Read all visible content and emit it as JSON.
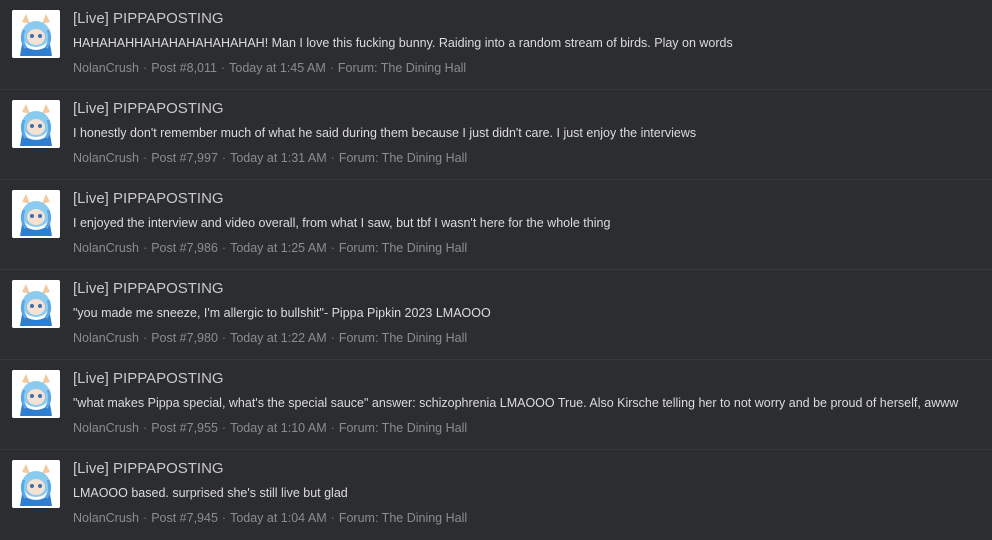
{
  "colors": {
    "background": "#2b2d31",
    "title": "#c9c9c9",
    "snippet": "#dcdcdc",
    "meta": "#8a8c90"
  },
  "separator": "·",
  "posts": [
    {
      "title": "[Live] PIPPAPOSTING",
      "snippet": "HAHAHAHHAHAHAHAHAHAHAH! Man I love this fucking bunny. Raiding into a random stream of birds. Play on words",
      "author": "NolanCrush",
      "post_number": "Post #8,011",
      "time": "Today at 1:45 AM",
      "forum": "Forum: The Dining Hall"
    },
    {
      "title": "[Live] PIPPAPOSTING",
      "snippet": "I honestly don't remember much of what he said during them because I just didn't care. I just enjoy the interviews",
      "author": "NolanCrush",
      "post_number": "Post #7,997",
      "time": "Today at 1:31 AM",
      "forum": "Forum: The Dining Hall"
    },
    {
      "title": "[Live] PIPPAPOSTING",
      "snippet": "I enjoyed the interview and video overall, from what I saw, but tbf I wasn't here for the whole thing",
      "author": "NolanCrush",
      "post_number": "Post #7,986",
      "time": "Today at 1:25 AM",
      "forum": "Forum: The Dining Hall"
    },
    {
      "title": "[Live] PIPPAPOSTING",
      "snippet": "\"you made me sneeze, I'm allergic to bullshit\"- Pippa Pipkin 2023 LMAOOO",
      "author": "NolanCrush",
      "post_number": "Post #7,980",
      "time": "Today at 1:22 AM",
      "forum": "Forum: The Dining Hall"
    },
    {
      "title": "[Live] PIPPAPOSTING",
      "snippet": "\"what makes Pippa special, what's the special sauce\" answer: schizophrenia LMAOOO True. Also Kirsche telling her to not worry and be proud of herself, awww",
      "author": "NolanCrush",
      "post_number": "Post #7,955",
      "time": "Today at 1:10 AM",
      "forum": "Forum: The Dining Hall"
    },
    {
      "title": "[Live] PIPPAPOSTING",
      "snippet": "LMAOOO based. surprised she's still live but glad",
      "author": "NolanCrush",
      "post_number": "Post #7,945",
      "time": "Today at 1:04 AM",
      "forum": "Forum: The Dining Hall"
    }
  ]
}
